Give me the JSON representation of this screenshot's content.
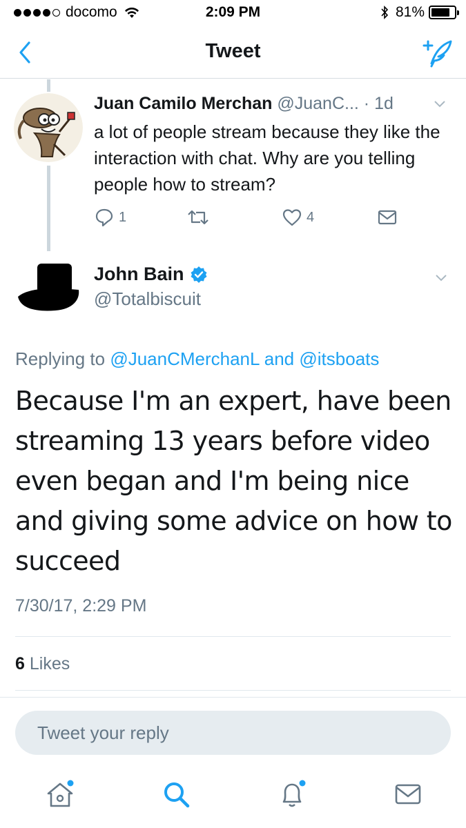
{
  "status_bar": {
    "carrier": "docomo",
    "time": "2:09 PM",
    "battery": "81%",
    "battery_level": 0.81
  },
  "nav": {
    "title": "Tweet",
    "back_icon": "chevron-left-icon",
    "compose_icon": "compose-tweet-icon"
  },
  "reply_context": {
    "name": "Juan Camilo Merchan",
    "handle": "@JuanC...",
    "time": "· 1d",
    "text": "a lot of people stream because they like the interaction with chat. Why are you telling people how to stream?",
    "actions": {
      "reply_count": "1",
      "retweet_count": "",
      "like_count": "4"
    }
  },
  "tweet": {
    "name": "John Bain",
    "handle": "@Totalbiscuit",
    "replying_prefix": "Replying to",
    "mention1": "@JuanCMerchanL",
    "and": "and",
    "mention2": "@itsboats",
    "text": "Because I'm an expert, have been streaming 13 years before video even began and I'm being nice and giving some advice on how to succeed",
    "timestamp": "7/30/17, 2:29 PM",
    "likes_count": "6",
    "likes_label": "Likes"
  },
  "reply_box": {
    "placeholder": "Tweet your reply"
  },
  "tabbar": {
    "items": [
      "home-icon",
      "search-icon",
      "notifications-icon",
      "messages-icon"
    ]
  },
  "colors": {
    "accent": "#1da1f2",
    "secondary_text": "#657786",
    "primary_text": "#14171a"
  }
}
